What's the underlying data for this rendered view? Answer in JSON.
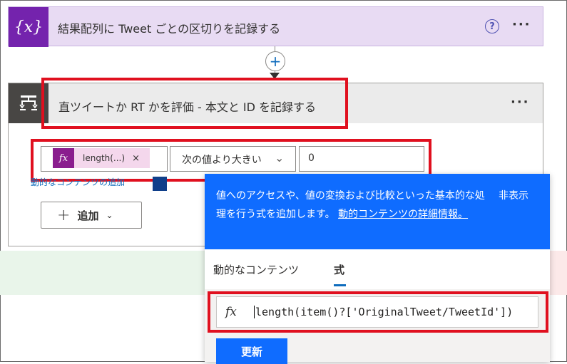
{
  "scope_action": {
    "icon": "curly-braces-x-icon",
    "icon_glyph": "{x}",
    "title": "結果配列に Tweet ごとの区切りを記録する",
    "help_glyph": "?",
    "more_glyph": "···"
  },
  "connector": {
    "plus_glyph": "+"
  },
  "condition": {
    "icon": "condition-icon",
    "title": "直ツイートか RT かを評価 - 本文と ID を記録する",
    "more_glyph": "···",
    "left_token": {
      "fx_glyph": "fx",
      "label": "length(...)",
      "close_glyph": "×"
    },
    "operator": "次の値より大きい",
    "operator_chevron": "⌄",
    "right_value": "0",
    "dynamic_link": "動的なコンテンツの追加",
    "add_button": {
      "plus_glyph": "+",
      "label": "追加",
      "chevron": "⌄"
    }
  },
  "popup": {
    "description_1": "値へのアクセスや、値の変換および比較といった基本的な処理を行う式を追加します。",
    "description_link": "動的コンテンツの詳細情報。",
    "hide_label": "非表示",
    "tabs": [
      {
        "label": "動的なコンテンツ",
        "active": false
      },
      {
        "label": "式",
        "active": true
      }
    ],
    "expression": {
      "fx_glyph": "fx",
      "value": "length(item()?['OriginalTweet/TweetId'])"
    },
    "update_label": "更新"
  },
  "colors": {
    "accent_blue": "#0f6cff",
    "scope_purple": "#7423ad",
    "token_magenta": "#8a1d8e",
    "highlight_red": "#e0101f"
  }
}
